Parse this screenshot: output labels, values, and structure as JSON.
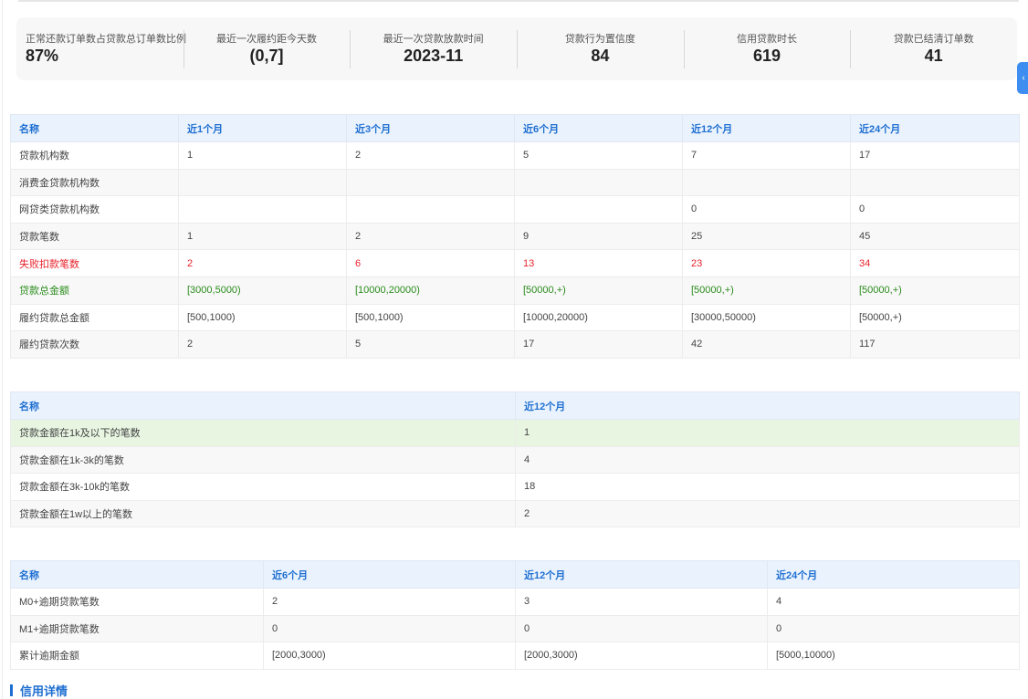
{
  "stats": [
    {
      "label": "正常还款订单数占贷款总订单数比例",
      "value": "87%"
    },
    {
      "label": "最近一次履约距今天数",
      "value": "(0,7]"
    },
    {
      "label": "最近一次贷款放款时间",
      "value": "2023-11"
    },
    {
      "label": "贷款行为置信度",
      "value": "84"
    },
    {
      "label": "信用贷款时长",
      "value": "619"
    },
    {
      "label": "贷款已结清订单数",
      "value": "41"
    }
  ],
  "side_tab": {
    "label": "‹"
  },
  "table1": {
    "headers": [
      "名称",
      "近1个月",
      "近3个月",
      "近6个月",
      "近12个月",
      "近24个月"
    ],
    "rows": [
      [
        "贷款机构数",
        "1",
        "2",
        "5",
        "7",
        "17"
      ],
      [
        "消费金贷款机构数",
        "",
        "",
        "",
        "",
        ""
      ],
      [
        "网贷类贷款机构数",
        "",
        "",
        "",
        "0",
        "0"
      ],
      [
        "贷款笔数",
        "1",
        "2",
        "9",
        "25",
        "45"
      ],
      [
        "失败扣款笔数",
        "2",
        "6",
        "13",
        "23",
        "34"
      ],
      [
        "贷款总金额",
        "[3000,5000)",
        "[10000,20000)",
        "[50000,+)",
        "[50000,+)",
        "[50000,+)"
      ],
      [
        "履约贷款总金额",
        "[500,1000)",
        "[500,1000)",
        "[10000,20000)",
        "[30000,50000)",
        "[50000,+)"
      ],
      [
        "履约贷款次数",
        "2",
        "5",
        "17",
        "42",
        "117"
      ]
    ]
  },
  "table2": {
    "headers": [
      "名称",
      "近12个月"
    ],
    "rows": [
      [
        "贷款金额在1k及以下的笔数",
        "1"
      ],
      [
        "贷款金额在1k-3k的笔数",
        "4"
      ],
      [
        "贷款金额在3k-10k的笔数",
        "18"
      ],
      [
        "贷款金额在1w以上的笔数",
        "2"
      ]
    ]
  },
  "table3": {
    "headers": [
      "名称",
      "近6个月",
      "近12个月",
      "近24个月"
    ],
    "rows": [
      [
        "M0+逾期贷款笔数",
        "2",
        "3",
        "4"
      ],
      [
        "M1+逾期贷款笔数",
        "0",
        "0",
        "0"
      ],
      [
        "累计逾期金额",
        "[2000,3000)",
        "[2000,3000)",
        "[5000,10000)"
      ]
    ]
  },
  "section": {
    "title": "信用详情"
  }
}
